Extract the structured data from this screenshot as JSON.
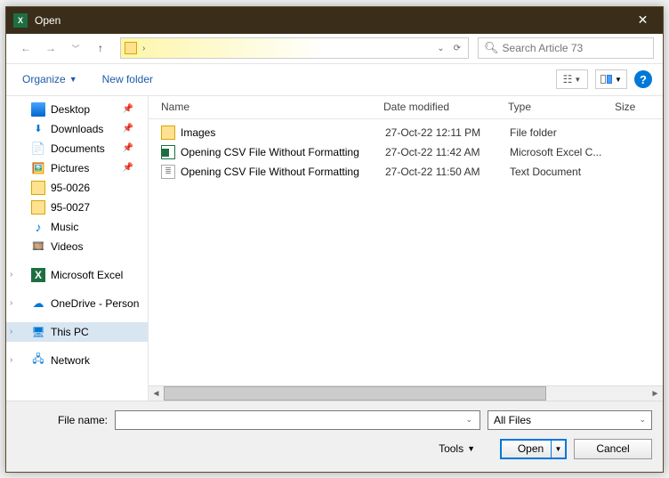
{
  "titlebar": {
    "title": "Open"
  },
  "search": {
    "placeholder": "Search Article 73"
  },
  "toolbar": {
    "organize": "Organize",
    "newFolder": "New folder"
  },
  "columns": {
    "name": "Name",
    "date": "Date modified",
    "type": "Type",
    "size": "Size"
  },
  "sidebar": {
    "quick": [
      {
        "label": "Desktop",
        "icon": "desktop",
        "pin": true
      },
      {
        "label": "Downloads",
        "icon": "dl",
        "pin": true
      },
      {
        "label": "Documents",
        "icon": "doc",
        "pin": true
      },
      {
        "label": "Pictures",
        "icon": "pic",
        "pin": true
      },
      {
        "label": "95-0026",
        "icon": "folder"
      },
      {
        "label": "95-0027",
        "icon": "folder"
      },
      {
        "label": "Music",
        "icon": "music"
      },
      {
        "label": "Videos",
        "icon": "video"
      }
    ],
    "group2": [
      {
        "label": "Microsoft Excel",
        "icon": "excel"
      }
    ],
    "group3": [
      {
        "label": "OneDrive - Person",
        "icon": "onedrive"
      }
    ],
    "group4": [
      {
        "label": "This PC",
        "icon": "pc",
        "selected": true
      }
    ],
    "group5": [
      {
        "label": "Network",
        "icon": "net"
      }
    ]
  },
  "files": [
    {
      "name": "Images",
      "date": "27-Oct-22 12:11 PM",
      "type": "File folder",
      "icon": "folder"
    },
    {
      "name": "Opening CSV File Without Formatting",
      "date": "27-Oct-22 11:42 AM",
      "type": "Microsoft Excel C...",
      "icon": "excel"
    },
    {
      "name": "Opening CSV File Without Formatting",
      "date": "27-Oct-22 11:50 AM",
      "type": "Text Document",
      "icon": "txt"
    }
  ],
  "footer": {
    "fileNameLabel": "File name:",
    "fileName": "",
    "filter": "All Files",
    "tools": "Tools",
    "open": "Open",
    "cancel": "Cancel"
  }
}
